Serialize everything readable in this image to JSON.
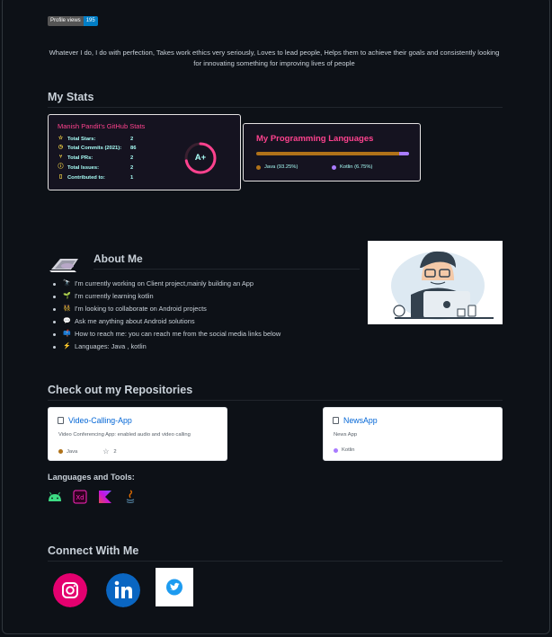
{
  "badge": {
    "label": "Profile views",
    "count": "195"
  },
  "intro": "Whatever I do, I do with perfection, Takes work ethics very seriously, Loves to lead people, Helps them to achieve their goals and consistently looking for innovating something for improving lives of people",
  "stats_heading": "My Stats",
  "stats_card": {
    "title": "Manish Pandit's GitHub Stats",
    "rows": [
      {
        "label": "Total Stars:",
        "value": "2",
        "icon": "star-icon"
      },
      {
        "label": "Total Commits (2021):",
        "value": "86",
        "icon": "clock-icon"
      },
      {
        "label": "Total PRs:",
        "value": "2",
        "icon": "pull-request-icon"
      },
      {
        "label": "Total Issues:",
        "value": "2",
        "icon": "issue-icon"
      },
      {
        "label": "Contributed to:",
        "value": "1",
        "icon": "repo-icon"
      }
    ],
    "rank": "A+",
    "rank_progress": 0.72,
    "colors": {
      "title": "#fe428e",
      "text": "#a9fef7",
      "icon": "#f8d847",
      "bg": "#151320"
    }
  },
  "lang_card": {
    "title": "My Programming Languages",
    "languages": [
      {
        "name": "Java (93.25%)",
        "percent": 93.25,
        "color": "#b07219"
      },
      {
        "name": "Kotlin (6.75%)",
        "percent": 6.75,
        "color": "#a97bff"
      }
    ]
  },
  "about_heading": "About Me",
  "about_items": [
    {
      "emoji": "🔭",
      "text": "I'm currently working on Client project,mainly building an App"
    },
    {
      "emoji": "🌱",
      "text": "I'm currently learning kotlin"
    },
    {
      "emoji": "👯",
      "text": "I'm looking to collaborate on Android projects"
    },
    {
      "emoji": "💬",
      "text": "Ask me anything about Android solutions"
    },
    {
      "emoji": "📫",
      "text": "How to reach me: you can reach me from the social media links below"
    },
    {
      "emoji": "⚡",
      "text": "Languages: Java , kotlin"
    }
  ],
  "repos_heading": "Check out my Repositories",
  "repos": [
    {
      "name": "Video-Calling-App",
      "description": "Video Conferencing App: enabled audio and video calling",
      "language": "Java",
      "lang_color": "#b07219",
      "stars": "2"
    },
    {
      "name": "NewsApp",
      "description": "News App",
      "language": "Kotlin",
      "lang_color": "#a97bff",
      "stars": ""
    }
  ],
  "tools_heading": "Languages and Tools:",
  "tools": [
    "android-icon",
    "adobe-xd-icon",
    "kotlin-icon",
    "java-icon"
  ],
  "connect_heading": "Connect With Me",
  "socials": [
    "instagram-icon",
    "linkedin-icon",
    "twitter-icon"
  ]
}
